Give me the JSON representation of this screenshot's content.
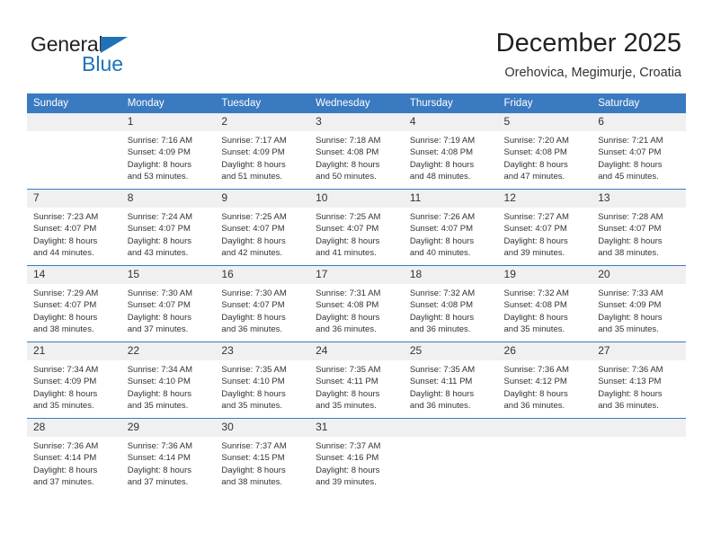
{
  "logo": {
    "text_primary": "General",
    "text_secondary": "Blue",
    "triangle_icon": "triangle-icon",
    "brand_color": "#1f72b8"
  },
  "header": {
    "title": "December 2025",
    "subtitle": "Orehovica, Megimurje, Croatia"
  },
  "calendar": {
    "header_color": "#3a7ac0",
    "daynum_band_color": "#f0f0f0",
    "weekday_headers": [
      "Sunday",
      "Monday",
      "Tuesday",
      "Wednesday",
      "Thursday",
      "Friday",
      "Saturday"
    ],
    "weeks": [
      [
        {
          "day": "",
          "sunrise": "",
          "sunset": "",
          "daylight_line1": "",
          "daylight_line2": ""
        },
        {
          "day": "1",
          "sunrise": "Sunrise: 7:16 AM",
          "sunset": "Sunset: 4:09 PM",
          "daylight_line1": "Daylight: 8 hours",
          "daylight_line2": "and 53 minutes."
        },
        {
          "day": "2",
          "sunrise": "Sunrise: 7:17 AM",
          "sunset": "Sunset: 4:09 PM",
          "daylight_line1": "Daylight: 8 hours",
          "daylight_line2": "and 51 minutes."
        },
        {
          "day": "3",
          "sunrise": "Sunrise: 7:18 AM",
          "sunset": "Sunset: 4:08 PM",
          "daylight_line1": "Daylight: 8 hours",
          "daylight_line2": "and 50 minutes."
        },
        {
          "day": "4",
          "sunrise": "Sunrise: 7:19 AM",
          "sunset": "Sunset: 4:08 PM",
          "daylight_line1": "Daylight: 8 hours",
          "daylight_line2": "and 48 minutes."
        },
        {
          "day": "5",
          "sunrise": "Sunrise: 7:20 AM",
          "sunset": "Sunset: 4:08 PM",
          "daylight_line1": "Daylight: 8 hours",
          "daylight_line2": "and 47 minutes."
        },
        {
          "day": "6",
          "sunrise": "Sunrise: 7:21 AM",
          "sunset": "Sunset: 4:07 PM",
          "daylight_line1": "Daylight: 8 hours",
          "daylight_line2": "and 45 minutes."
        }
      ],
      [
        {
          "day": "7",
          "sunrise": "Sunrise: 7:23 AM",
          "sunset": "Sunset: 4:07 PM",
          "daylight_line1": "Daylight: 8 hours",
          "daylight_line2": "and 44 minutes."
        },
        {
          "day": "8",
          "sunrise": "Sunrise: 7:24 AM",
          "sunset": "Sunset: 4:07 PM",
          "daylight_line1": "Daylight: 8 hours",
          "daylight_line2": "and 43 minutes."
        },
        {
          "day": "9",
          "sunrise": "Sunrise: 7:25 AM",
          "sunset": "Sunset: 4:07 PM",
          "daylight_line1": "Daylight: 8 hours",
          "daylight_line2": "and 42 minutes."
        },
        {
          "day": "10",
          "sunrise": "Sunrise: 7:25 AM",
          "sunset": "Sunset: 4:07 PM",
          "daylight_line1": "Daylight: 8 hours",
          "daylight_line2": "and 41 minutes."
        },
        {
          "day": "11",
          "sunrise": "Sunrise: 7:26 AM",
          "sunset": "Sunset: 4:07 PM",
          "daylight_line1": "Daylight: 8 hours",
          "daylight_line2": "and 40 minutes."
        },
        {
          "day": "12",
          "sunrise": "Sunrise: 7:27 AM",
          "sunset": "Sunset: 4:07 PM",
          "daylight_line1": "Daylight: 8 hours",
          "daylight_line2": "and 39 minutes."
        },
        {
          "day": "13",
          "sunrise": "Sunrise: 7:28 AM",
          "sunset": "Sunset: 4:07 PM",
          "daylight_line1": "Daylight: 8 hours",
          "daylight_line2": "and 38 minutes."
        }
      ],
      [
        {
          "day": "14",
          "sunrise": "Sunrise: 7:29 AM",
          "sunset": "Sunset: 4:07 PM",
          "daylight_line1": "Daylight: 8 hours",
          "daylight_line2": "and 38 minutes."
        },
        {
          "day": "15",
          "sunrise": "Sunrise: 7:30 AM",
          "sunset": "Sunset: 4:07 PM",
          "daylight_line1": "Daylight: 8 hours",
          "daylight_line2": "and 37 minutes."
        },
        {
          "day": "16",
          "sunrise": "Sunrise: 7:30 AM",
          "sunset": "Sunset: 4:07 PM",
          "daylight_line1": "Daylight: 8 hours",
          "daylight_line2": "and 36 minutes."
        },
        {
          "day": "17",
          "sunrise": "Sunrise: 7:31 AM",
          "sunset": "Sunset: 4:08 PM",
          "daylight_line1": "Daylight: 8 hours",
          "daylight_line2": "and 36 minutes."
        },
        {
          "day": "18",
          "sunrise": "Sunrise: 7:32 AM",
          "sunset": "Sunset: 4:08 PM",
          "daylight_line1": "Daylight: 8 hours",
          "daylight_line2": "and 36 minutes."
        },
        {
          "day": "19",
          "sunrise": "Sunrise: 7:32 AM",
          "sunset": "Sunset: 4:08 PM",
          "daylight_line1": "Daylight: 8 hours",
          "daylight_line2": "and 35 minutes."
        },
        {
          "day": "20",
          "sunrise": "Sunrise: 7:33 AM",
          "sunset": "Sunset: 4:09 PM",
          "daylight_line1": "Daylight: 8 hours",
          "daylight_line2": "and 35 minutes."
        }
      ],
      [
        {
          "day": "21",
          "sunrise": "Sunrise: 7:34 AM",
          "sunset": "Sunset: 4:09 PM",
          "daylight_line1": "Daylight: 8 hours",
          "daylight_line2": "and 35 minutes."
        },
        {
          "day": "22",
          "sunrise": "Sunrise: 7:34 AM",
          "sunset": "Sunset: 4:10 PM",
          "daylight_line1": "Daylight: 8 hours",
          "daylight_line2": "and 35 minutes."
        },
        {
          "day": "23",
          "sunrise": "Sunrise: 7:35 AM",
          "sunset": "Sunset: 4:10 PM",
          "daylight_line1": "Daylight: 8 hours",
          "daylight_line2": "and 35 minutes."
        },
        {
          "day": "24",
          "sunrise": "Sunrise: 7:35 AM",
          "sunset": "Sunset: 4:11 PM",
          "daylight_line1": "Daylight: 8 hours",
          "daylight_line2": "and 35 minutes."
        },
        {
          "day": "25",
          "sunrise": "Sunrise: 7:35 AM",
          "sunset": "Sunset: 4:11 PM",
          "daylight_line1": "Daylight: 8 hours",
          "daylight_line2": "and 36 minutes."
        },
        {
          "day": "26",
          "sunrise": "Sunrise: 7:36 AM",
          "sunset": "Sunset: 4:12 PM",
          "daylight_line1": "Daylight: 8 hours",
          "daylight_line2": "and 36 minutes."
        },
        {
          "day": "27",
          "sunrise": "Sunrise: 7:36 AM",
          "sunset": "Sunset: 4:13 PM",
          "daylight_line1": "Daylight: 8 hours",
          "daylight_line2": "and 36 minutes."
        }
      ],
      [
        {
          "day": "28",
          "sunrise": "Sunrise: 7:36 AM",
          "sunset": "Sunset: 4:14 PM",
          "daylight_line1": "Daylight: 8 hours",
          "daylight_line2": "and 37 minutes."
        },
        {
          "day": "29",
          "sunrise": "Sunrise: 7:36 AM",
          "sunset": "Sunset: 4:14 PM",
          "daylight_line1": "Daylight: 8 hours",
          "daylight_line2": "and 37 minutes."
        },
        {
          "day": "30",
          "sunrise": "Sunrise: 7:37 AM",
          "sunset": "Sunset: 4:15 PM",
          "daylight_line1": "Daylight: 8 hours",
          "daylight_line2": "and 38 minutes."
        },
        {
          "day": "31",
          "sunrise": "Sunrise: 7:37 AM",
          "sunset": "Sunset: 4:16 PM",
          "daylight_line1": "Daylight: 8 hours",
          "daylight_line2": "and 39 minutes."
        },
        {
          "day": "",
          "sunrise": "",
          "sunset": "",
          "daylight_line1": "",
          "daylight_line2": ""
        },
        {
          "day": "",
          "sunrise": "",
          "sunset": "",
          "daylight_line1": "",
          "daylight_line2": ""
        },
        {
          "day": "",
          "sunrise": "",
          "sunset": "",
          "daylight_line1": "",
          "daylight_line2": ""
        }
      ]
    ]
  }
}
